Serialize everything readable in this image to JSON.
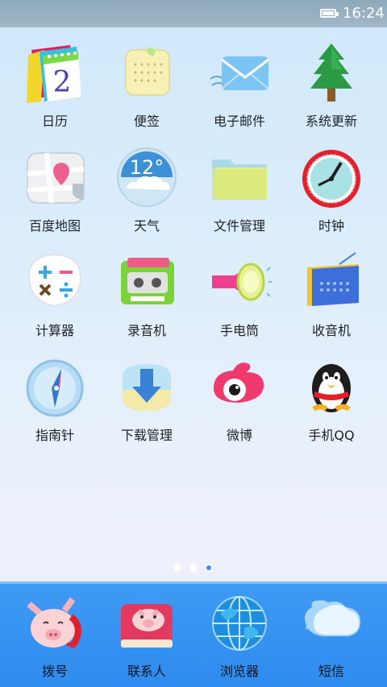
{
  "status_bar": {
    "time": "16:24"
  },
  "apps": [
    {
      "label": "日历",
      "icon": "calendar-icon",
      "day": "2"
    },
    {
      "label": "便签",
      "icon": "notes-icon"
    },
    {
      "label": "电子邮件",
      "icon": "email-icon"
    },
    {
      "label": "系统更新",
      "icon": "tree-update-icon"
    },
    {
      "label": "百度地图",
      "icon": "map-icon"
    },
    {
      "label": "天气",
      "icon": "weather-icon",
      "temperature": "12°"
    },
    {
      "label": "文件管理",
      "icon": "folder-icon"
    },
    {
      "label": "时钟",
      "icon": "clock-icon"
    },
    {
      "label": "计算器",
      "icon": "calculator-icon"
    },
    {
      "label": "录音机",
      "icon": "cassette-icon"
    },
    {
      "label": "手电筒",
      "icon": "flashlight-icon"
    },
    {
      "label": "收音机",
      "icon": "radio-icon"
    },
    {
      "label": "指南针",
      "icon": "compass-icon"
    },
    {
      "label": "下载管理",
      "icon": "download-icon"
    },
    {
      "label": "微博",
      "icon": "weibo-icon"
    },
    {
      "label": "手机QQ",
      "icon": "qq-penguin-icon"
    }
  ],
  "pager": {
    "pages": 3,
    "current": 3
  },
  "dock": [
    {
      "label": "拨号",
      "icon": "pig-phone-icon"
    },
    {
      "label": "联系人",
      "icon": "pig-contacts-icon"
    },
    {
      "label": "浏览器",
      "icon": "globe-icon"
    },
    {
      "label": "短信",
      "icon": "chat-bubble-icon"
    }
  ],
  "colors": {
    "dock": "#2f8cf0",
    "status_bar": "#9ab3c4",
    "page_dot_active": "#3d8ee8"
  }
}
